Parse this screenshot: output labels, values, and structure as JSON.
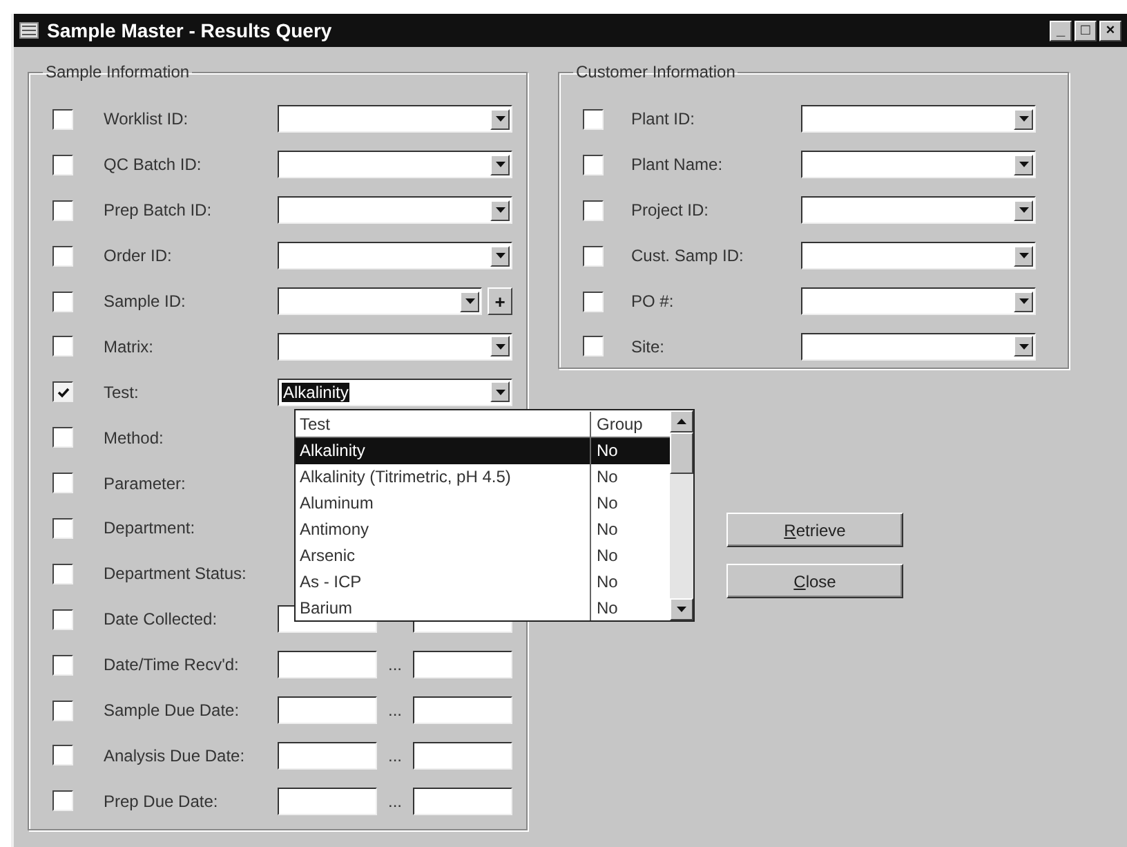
{
  "window": {
    "title": "Sample Master - Results Query",
    "controls": [
      "_",
      "□",
      "×"
    ]
  },
  "sample_information": {
    "title": "Sample Information",
    "rows": [
      {
        "label": "Worklist ID:",
        "checked": false,
        "kind": "combo"
      },
      {
        "label": "QC Batch ID:",
        "checked": false,
        "kind": "combo"
      },
      {
        "label": "Prep Batch ID:",
        "checked": false,
        "kind": "combo"
      },
      {
        "label": "Order ID:",
        "checked": false,
        "kind": "combo"
      },
      {
        "label": "Sample ID:",
        "checked": false,
        "kind": "combo-plus",
        "button": "+"
      },
      {
        "label": "Matrix:",
        "checked": false,
        "kind": "combo"
      },
      {
        "label": "Test:",
        "checked": true,
        "kind": "combo",
        "value": "Alkalinity"
      },
      {
        "label": "Method:",
        "checked": false,
        "kind": "covered"
      },
      {
        "label": "Parameter:",
        "checked": false,
        "kind": "covered"
      },
      {
        "label": "Department:",
        "checked": false,
        "kind": "covered"
      },
      {
        "label": "Department Status:",
        "checked": false,
        "kind": "covered"
      },
      {
        "label": "Date Collected:",
        "checked": false,
        "kind": "date-range"
      },
      {
        "label": "Date/Time Recv'd:",
        "checked": false,
        "kind": "date-range",
        "separator": "..."
      },
      {
        "label": "Sample Due Date:",
        "checked": false,
        "kind": "date-range",
        "separator": "..."
      },
      {
        "label": "Analysis Due Date:",
        "checked": false,
        "kind": "date-range",
        "separator": "..."
      },
      {
        "label": "Prep Due Date:",
        "checked": false,
        "kind": "date-range",
        "separator": "..."
      }
    ]
  },
  "customer_information": {
    "title": "Customer Information",
    "rows": [
      {
        "label": "Plant ID:",
        "checked": false
      },
      {
        "label": "Plant Name:",
        "checked": false
      },
      {
        "label": "Project ID:",
        "checked": false
      },
      {
        "label": "Cust. Samp ID:",
        "checked": false
      },
      {
        "label": "PO #:",
        "checked": false
      },
      {
        "label": "Site:",
        "checked": false
      }
    ]
  },
  "dropdown": {
    "columns": [
      "Test",
      "Group"
    ],
    "rows": [
      {
        "test": "Alkalinity",
        "group": "No",
        "selected": true
      },
      {
        "test": "Alkalinity (Titrimetric, pH 4.5)",
        "group": "No",
        "selected": false
      },
      {
        "test": "Aluminum",
        "group": "No",
        "selected": false
      },
      {
        "test": "Antimony",
        "group": "No",
        "selected": false
      },
      {
        "test": "Arsenic",
        "group": "No",
        "selected": false
      },
      {
        "test": "As - ICP",
        "group": "No",
        "selected": false
      },
      {
        "test": "Barium",
        "group": "No",
        "selected": false
      }
    ]
  },
  "buttons": [
    {
      "key": "R",
      "rest": "etrieve"
    },
    {
      "key": "C",
      "rest": "lose"
    }
  ]
}
